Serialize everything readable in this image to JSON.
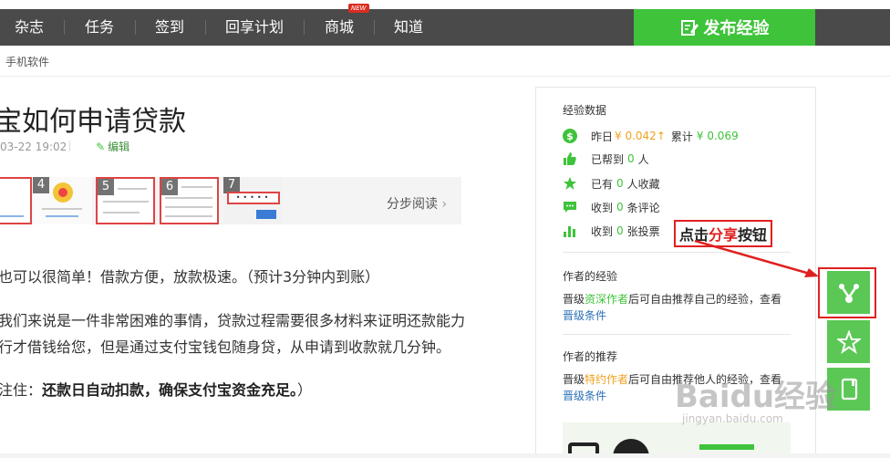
{
  "nav": {
    "items": [
      "杂志",
      "任务",
      "签到",
      "回享计划",
      "商城",
      "知道"
    ],
    "new_badge": "NEW",
    "publish_label": "发布经验"
  },
  "breadcrumb": "手机软件",
  "article": {
    "title": "宝如何申请贷款",
    "date": "03-22 19:02",
    "edit_label": "编辑",
    "thumbs": [
      "4",
      "5",
      "6",
      "7"
    ],
    "read_steps": "分步阅读",
    "para1": "也可以很简单！借款方便，放款极速。（预计3分钟内到账）",
    "para2_line1": "我们来说是一件非常困难的事情，贷款过程需要很多材料来证明还款能力",
    "para2_line2": "行才借钱给您，但是通过支付宝钱包随身贷，从申请到收款就几分钟。",
    "para3_prefix": "注住：",
    "para3_bold": "还款日自动扣款，确保支付宝资金充足。",
    "para3_suffix": "）"
  },
  "sidebar": {
    "stats_title": "经验数据",
    "stats": {
      "yesterday_label": "昨日",
      "yesterday_value": "¥ 0.042",
      "total_label": "累计",
      "total_value": "¥ 0.069",
      "helped_prefix": "已帮到",
      "helped_count": "0",
      "helped_suffix": "人",
      "collected_prefix": "已有",
      "collected_count": "0",
      "collected_suffix": "人收藏",
      "comments_prefix": "收到",
      "comments_count": "0",
      "comments_suffix": "条评论",
      "votes_prefix": "收到",
      "votes_count": "0",
      "votes_suffix": "张投票"
    },
    "author_exp_title": "作者的经验",
    "author_exp_text1": "晋级",
    "author_exp_link": "资深作者",
    "author_exp_text2": "后可自由推荐自己的经验，查看",
    "author_exp_link2": "晋级条件",
    "author_rec_title": "作者的推荐",
    "author_rec_text1": "晋级",
    "author_rec_link": "特约作者",
    "author_rec_text2": "后可自由推荐他人的经验，查看",
    "author_rec_link2": "晋级条件"
  },
  "annotation": {
    "prefix": "点击",
    "highlight": "分享",
    "suffix": "按钮"
  },
  "watermark": {
    "main": "Baidu经验",
    "sub": "jingyan.baidu.com"
  },
  "colors": {
    "nav_bg": "#4a4a4a",
    "accent_green": "#3ec33a",
    "annotation_red": "#e02020",
    "link_blue": "#2b6fb6"
  }
}
